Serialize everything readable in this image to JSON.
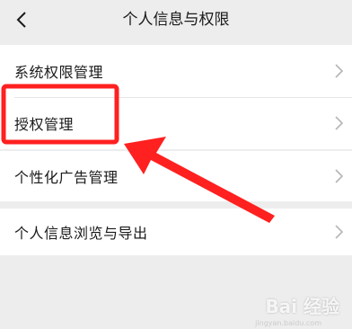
{
  "header": {
    "title": "个人信息与权限"
  },
  "items": [
    {
      "label": "系统权限管理"
    },
    {
      "label": "授权管理"
    },
    {
      "label": "个性化广告管理"
    },
    {
      "label": "个人信息浏览与导出"
    }
  ],
  "colors": {
    "background": "#ededed",
    "card": "#ffffff",
    "highlight": "#ff2020"
  },
  "icons": {
    "back": "chevron-left-icon",
    "row": "chevron-right-icon"
  },
  "watermark": {
    "brand": "Bai 经验",
    "sub": "jingyan.baidu.com"
  }
}
